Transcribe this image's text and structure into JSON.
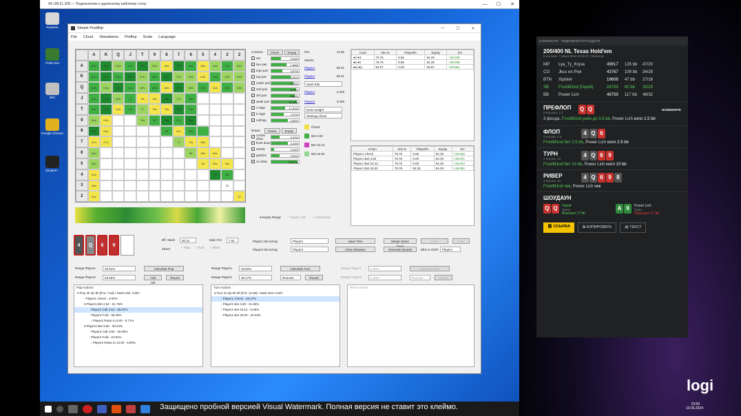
{
  "rdp": {
    "title": "94.198.51.208 — Подключение к удаленному рабочему столу",
    "min": "—",
    "max": "☐",
    "close": "✕"
  },
  "desktop_icons": [
    {
      "label": "Корзина",
      "color": "#d8d8d8"
    },
    {
      "label": "Poker Bot",
      "color": "#3a7a30"
    },
    {
      "label": "4RC",
      "color": "#c0c0c0"
    },
    {
      "label": "Google Chrome",
      "color": "#e0b020"
    },
    {
      "label": "SimpleP...",
      "color": "#222"
    }
  ],
  "app": {
    "title": "Simple Postflop",
    "menu": [
      "File",
      "Cloud",
      "Standalone",
      "Preflop",
      "Scale",
      "Language"
    ],
    "win_min": "—",
    "win_max": "☐",
    "win_close": "✕"
  },
  "grid": {
    "headers": [
      "A",
      "K",
      "Q",
      "J",
      "T",
      "9",
      "8",
      "7",
      "6",
      "5",
      "4",
      "3",
      "2"
    ],
    "cells": [
      [
        "AAo",
        "AKs",
        "AQs",
        "AJs",
        "ATs",
        "A9s",
        "A8s",
        "A7s",
        "A6s",
        "A5s",
        "A4s",
        "A3s",
        "A2s"
      ],
      [
        "AKo",
        "KK",
        "KQs",
        "KJs",
        "KTs",
        "K9s",
        "K8s",
        "K7s",
        "K6s",
        "K5s",
        "K4s",
        "K3s",
        "K2s"
      ],
      [
        "AQo",
        "KQo",
        "QQ",
        "QJs",
        "QTs",
        "Q9s",
        "Q8s",
        "Q7s",
        "Q6s",
        "Q5s",
        "Q4s",
        "Q3s",
        "Q2s"
      ],
      [
        "AJo",
        "KJo",
        "QJo",
        "JJ",
        "JTs",
        "J9s",
        "J8s",
        "J7s",
        "J6s",
        "",
        "",
        "",
        ""
      ],
      [
        "ATo",
        "KTo",
        "QTo",
        "JTo",
        "TT",
        "T9s",
        "T8s",
        "T7s",
        "T6s",
        "",
        "",
        "",
        ""
      ],
      [
        "A9o",
        "K9o",
        "",
        "",
        "T9o",
        "99",
        "98s",
        "97s",
        "96s",
        "",
        "",
        "",
        ""
      ],
      [
        "A8o",
        "K8o",
        "",
        "",
        "",
        "",
        "88",
        "87s",
        "86s",
        "",
        "",
        "",
        ""
      ],
      [
        "A7o",
        "K7o",
        "",
        "",
        "",
        "",
        "",
        "77",
        "76s",
        "65s",
        "",
        "",
        ""
      ],
      [
        "A6o",
        "",
        "",
        "",
        "",
        "",
        "",
        "",
        "66",
        "65s",
        "64s",
        "",
        ""
      ],
      [
        "A5o",
        "",
        "",
        "",
        "",
        "",
        "",
        "",
        "",
        "55",
        "54s",
        "53s",
        ""
      ],
      [
        "A4o",
        "",
        "",
        "",
        "",
        "",
        "",
        "",
        "",
        "",
        "44",
        "43s",
        ""
      ],
      [
        "A3o",
        "",
        "",
        "",
        "",
        "",
        "",
        "",
        "",
        "",
        "",
        "33",
        ""
      ],
      [
        "A2o",
        "",
        "",
        "",
        "",
        "",
        "",
        "",
        "",
        "",
        "",
        "",
        "22"
      ]
    ],
    "colors": [
      [
        3,
        4,
        2,
        3,
        4,
        2,
        1,
        4,
        3,
        1,
        2,
        3,
        2
      ],
      [
        3,
        4,
        3,
        4,
        2,
        3,
        4,
        2,
        2,
        1,
        3,
        2,
        2
      ],
      [
        3,
        2,
        4,
        3,
        2,
        3,
        1,
        4,
        2,
        3,
        1,
        3,
        2
      ],
      [
        3,
        4,
        2,
        3,
        1,
        1,
        4,
        2,
        3,
        0,
        0,
        0,
        0
      ],
      [
        3,
        4,
        1,
        3,
        2,
        1,
        1,
        4,
        3,
        0,
        0,
        0,
        0
      ],
      [
        2,
        1,
        0,
        0,
        2,
        3,
        4,
        3,
        4,
        0,
        0,
        0,
        0
      ],
      [
        4,
        1,
        0,
        0,
        0,
        0,
        3,
        1,
        3,
        3,
        0,
        0,
        0
      ],
      [
        1,
        1,
        0,
        0,
        0,
        0,
        0,
        2,
        1,
        1,
        0,
        0,
        0
      ],
      [
        2,
        0,
        0,
        0,
        0,
        0,
        0,
        0,
        2,
        1,
        1,
        0,
        0
      ],
      [
        2,
        0,
        0,
        0,
        0,
        0,
        0,
        0,
        0,
        1,
        1,
        1,
        0
      ],
      [
        1,
        0,
        0,
        0,
        0,
        0,
        0,
        0,
        0,
        0,
        4,
        3,
        0
      ],
      [
        1,
        0,
        0,
        0,
        0,
        0,
        0,
        0,
        0,
        0,
        0,
        0,
        0
      ],
      [
        1,
        0,
        0,
        0,
        0,
        0,
        0,
        0,
        0,
        0,
        0,
        0,
        1
      ]
    ]
  },
  "combos": {
    "label": "Combos",
    "check": "Check",
    "empty": "Empty",
    "items": [
      {
        "name": "set",
        "pct": "0.34%",
        "w": 0.34
      },
      {
        "name": "two pair",
        "pct": "1.68%",
        "w": 0.55
      },
      {
        "name": "trips pair",
        "pct": "0.67%",
        "w": 0.4
      },
      {
        "name": "top pair",
        "pct": "3.90%",
        "w": 0.7
      },
      {
        "name": "under pair",
        "pct": "7.63%",
        "w": 0.8
      },
      {
        "name": "2nd pair",
        "pct": "9.91%",
        "w": 0.9
      },
      {
        "name": "3rd pair",
        "pct": "8.68%",
        "w": 0.85
      },
      {
        "name": "weak pair",
        "pct": "10.45%",
        "w": 0.92
      },
      {
        "name": "A-high",
        "pct": "17.61%",
        "w": 0.5
      },
      {
        "name": "K-high",
        "pct": "2.37%",
        "w": 0.45
      },
      {
        "name": "nothing",
        "pct": "6.80%",
        "w": 0.6
      }
    ]
  },
  "draws": {
    "label": "Draws",
    "check": "Check",
    "empty": "Empty",
    "items": [
      {
        "name": "combo draw",
        "pct": "0.31%",
        "w": 0.3
      },
      {
        "name": "flush draw",
        "pct": "4.24%",
        "w": 0.6
      },
      {
        "name": "OESD",
        "pct": "0.04%",
        "w": 0.1
      },
      {
        "name": "gutshot",
        "pct": "0.94%",
        "w": 0.3
      },
      {
        "name": "no draw",
        "pct": "93.97%",
        "w": 0.95
      }
    ]
  },
  "pot": {
    "pot_label": "Pot:",
    "pot_value": "12.06",
    "stacks_label": "Stacks:",
    "p1": "Player1",
    "p1_value": "55.01",
    "p2": "Player1",
    "p2_value": "55.01",
    "nash": "Nash Eds",
    "p3": "Player1",
    "p3_value": "2.200",
    "p4": "Player2",
    "p4_value": "3.400",
    "weight": "None weight",
    "strategy": "Strategy Show"
  },
  "legend": [
    {
      "label": "Check",
      "color": "#f0e040"
    },
    {
      "label": "Bet 4.50",
      "color": "#3fb043"
    },
    {
      "label": "Bet 10.13",
      "color": "#d040c0"
    },
    {
      "label": "Bet 15.00",
      "color": "#90d890"
    }
  ],
  "card_table": {
    "headers": [
      "Card",
      "Abs.%",
      "Played%",
      "Equity",
      "EV"
    ],
    "rows": [
      [
        "♠4 ♥4",
        "78.76",
        "9.65",
        "94.29",
        "+26.040"
      ],
      [
        "♠6 ♦6",
        "78.75",
        "9.65",
        "94.29",
        "+26.039"
      ],
      [
        "♠Q ♦Q",
        "84.67",
        "0.00",
        "93.87",
        "+25.851"
      ]
    ]
  },
  "action_table": {
    "headers": [
      "Action",
      "Abs.%",
      "Played%",
      "Equity",
      "EV"
    ],
    "rows": [
      [
        "Player1 Check",
        "78.76",
        "9.65",
        "94.29",
        "+26.040"
      ],
      [
        "Player1 Bet 4.50",
        "78.76",
        "0.00",
        "94.29",
        "+25.571"
      ],
      [
        "Player1 Bet 10.13",
        "78.76",
        "0.00",
        "94.29",
        "+26.044"
      ],
      [
        "Player1 Bet 15.00",
        "78.76",
        "90.35",
        "94.29",
        "+26.050"
      ]
    ]
  },
  "radios": [
    "Equity Range",
    "Equity Call",
    "Fold Equity"
  ],
  "board": {
    "cards": [
      "4",
      "Q",
      "6",
      "9"
    ],
    "eff_stack_label": "Eff. Stack",
    "eff_stack": "50.13",
    "main_pot_label": "Main Pot",
    "main_pot": "7.62",
    "street_label": "Street",
    "streets": [
      "Flop",
      "Turn",
      "River"
    ]
  },
  "sizing": {
    "p1_label": "Player1 bet sizing:",
    "p1_sel": "Player1",
    "p2_label": "Player2 bet sizing:",
    "p2_sel": "Player2",
    "save_tree": "Save Tree",
    "clear_situation": "Clear Situation",
    "merge_tree": "Merge Same Trees",
    "generate_boards": "Generate Boards",
    "cash": "Cash",
    "who_oop": "Who is OOP:",
    "player1": "Player1",
    "new": "New"
  },
  "ranges": {
    "rp1": "Range Player1",
    "rp1_val": "46.91%",
    "rp2": "Range Player2",
    "rp2_val": "63.66%",
    "calc_flop": "Calculate Flop",
    "add_job": "Add Job",
    "round": "Round",
    "tp1": "Range Player1",
    "tp1_val": "29.52%",
    "tp2": "Range Player2",
    "tp2_val": "35.17%",
    "calc_turn": "Calculate Turn",
    "runouts": "Runouts",
    "round2": "Round",
    "rv1": "Range Player1",
    "rv1_val": "0.00%",
    "rv2": "Range Player2",
    "rv2_val": "0.00%",
    "calc_river": "Calculate River",
    "runouts2": "Runouts",
    "round3": "Round"
  },
  "trees": {
    "flop_title": "Flop Actions",
    "flop": [
      {
        "t": "▾ Flop 4h Qs 6h [Pot: 7.62] • Nash Dist: 2.587",
        "d": 0
      },
      {
        "t": "› Player1 Check - 0.00%",
        "d": 1
      },
      {
        "t": "▾ Player1 Bet 2.52 - 61.76%",
        "d": 1
      },
      {
        "t": "Player2 Call 2.52 - 58.07%",
        "d": 2,
        "hl": true
      },
      {
        "t": "Player2 Fold - 36.28%",
        "d": 2
      },
      {
        "t": "› Player2 Raise to 9.00 - 5.71%",
        "d": 2
      },
      {
        "t": "▾ Player1 Bet 3.80 - 38.24%",
        "d": 1
      },
      {
        "t": "Player2 Call 3.80 - 49.39%",
        "d": 2
      },
      {
        "t": "Player2 Fold - 44.81%",
        "d": 2
      },
      {
        "t": "› Player2 Raise to 12.50 - 5.80%",
        "d": 2
      }
    ],
    "turn_title": "Turn Actions",
    "turn": [
      {
        "t": "▾ Turn 4s Qs 6h 9h [Pot: 12.06] • Nash Dist: 0.907",
        "d": 0
      },
      {
        "t": "› Player1 Check - 49.27%",
        "d": 1,
        "hl": true
      },
      {
        "t": "› Player1 Bet 4.50 - 31.50%",
        "d": 1
      },
      {
        "t": "› Player1 Bet 10.12 - 0.00%",
        "d": 1
      },
      {
        "t": "› Player1 Bet 15.00 - 19.23%",
        "d": 1
      }
    ],
    "river_title": "River Actions"
  },
  "hud": {
    "top": "HAND2NOTE · ПОДРОБНОСТИ РАЗДАЧИ",
    "game": "200/400 NL Texas Hold'em",
    "game_sub": "5 игроков, 7 июня 2024 23:26:07, Winamax",
    "players": [
      {
        "pos": "MP",
        "name": "Lya_Ty_Krysa",
        "stack": "49917",
        "bb": "125 bb",
        "stat": "47/20",
        "hero": false
      },
      {
        "pos": "CO",
        "name": "Jkus en Piwi",
        "stack": "43767",
        "bb": "109 bb",
        "stat": "34/28",
        "hero": false
      },
      {
        "pos": "BTN",
        "name": "Xipister",
        "stack": "18608",
        "bb": "47 bb",
        "stat": "27/18",
        "hero": false
      },
      {
        "pos": "SB",
        "name": "FrostM1nd (Герой)",
        "stack": "24703",
        "bb": "62 bb",
        "stat": "32/23",
        "hero": true
      },
      {
        "pos": "BB",
        "name": "Power Lich",
        "stack": "46759",
        "bb": "117 bb",
        "stat": "46/32",
        "hero": false
      }
    ],
    "preflop": "ПРЕФЛОП",
    "preflop_sub": "5 игроков, 2.1",
    "preflop_text_a": "3 фолда, ",
    "preflop_text_b": "FrostM1nd рейз до 3.5 bb",
    "preflop_text_c": ", Power Lich ",
    "preflop_text_d": "колл 2.5 bb",
    "logo": "HAND2NOTE",
    "flop": "ФЛОП",
    "flop_sub": "2 игрока, 7.6",
    "flop_cards": [
      "4",
      "Q",
      "6"
    ],
    "flop_a": "FrostM1nd бет 2.5 bb",
    "flop_b": ", Power Lich ",
    "flop_c": "колл 2.5 bb",
    "turn": "ТУРН",
    "turn_sub": "2 игрока, 13",
    "turn_cards": [
      "4",
      "Q",
      "6",
      "9"
    ],
    "turn_a": "FrostM1nd бет 10 bb",
    "turn_b": ", Power Lich ",
    "turn_c": "колл 10 bb",
    "river": "РИВЕР",
    "river_sub": "2 игрока, 33",
    "river_cards": [
      "4",
      "Q",
      "6",
      "9",
      "8"
    ],
    "river_a": "FrostM1nd чек",
    "river_b": ", Power Lich ",
    "river_c": "чек",
    "showdown": "ШОУДАУН",
    "hero_name": "Герой",
    "hero_hand": "Трипс",
    "hero_win": "Выиграл 17 bb",
    "opp_name": "Power Lich",
    "opp_hand": "Пара",
    "opp_lose": "Проиграл 17 bb",
    "btn_link": "ССЫЛКА",
    "btn_copy": "КОПИРОВАТЬ",
    "btn_text": "ТЕКСТ"
  },
  "watermark": "Защищено пробной версией Visual Watermark. Полная версия не ставит это клеймо.",
  "clock": {
    "time": "19:58",
    "date": "10.06.2024"
  },
  "logi": "logi"
}
